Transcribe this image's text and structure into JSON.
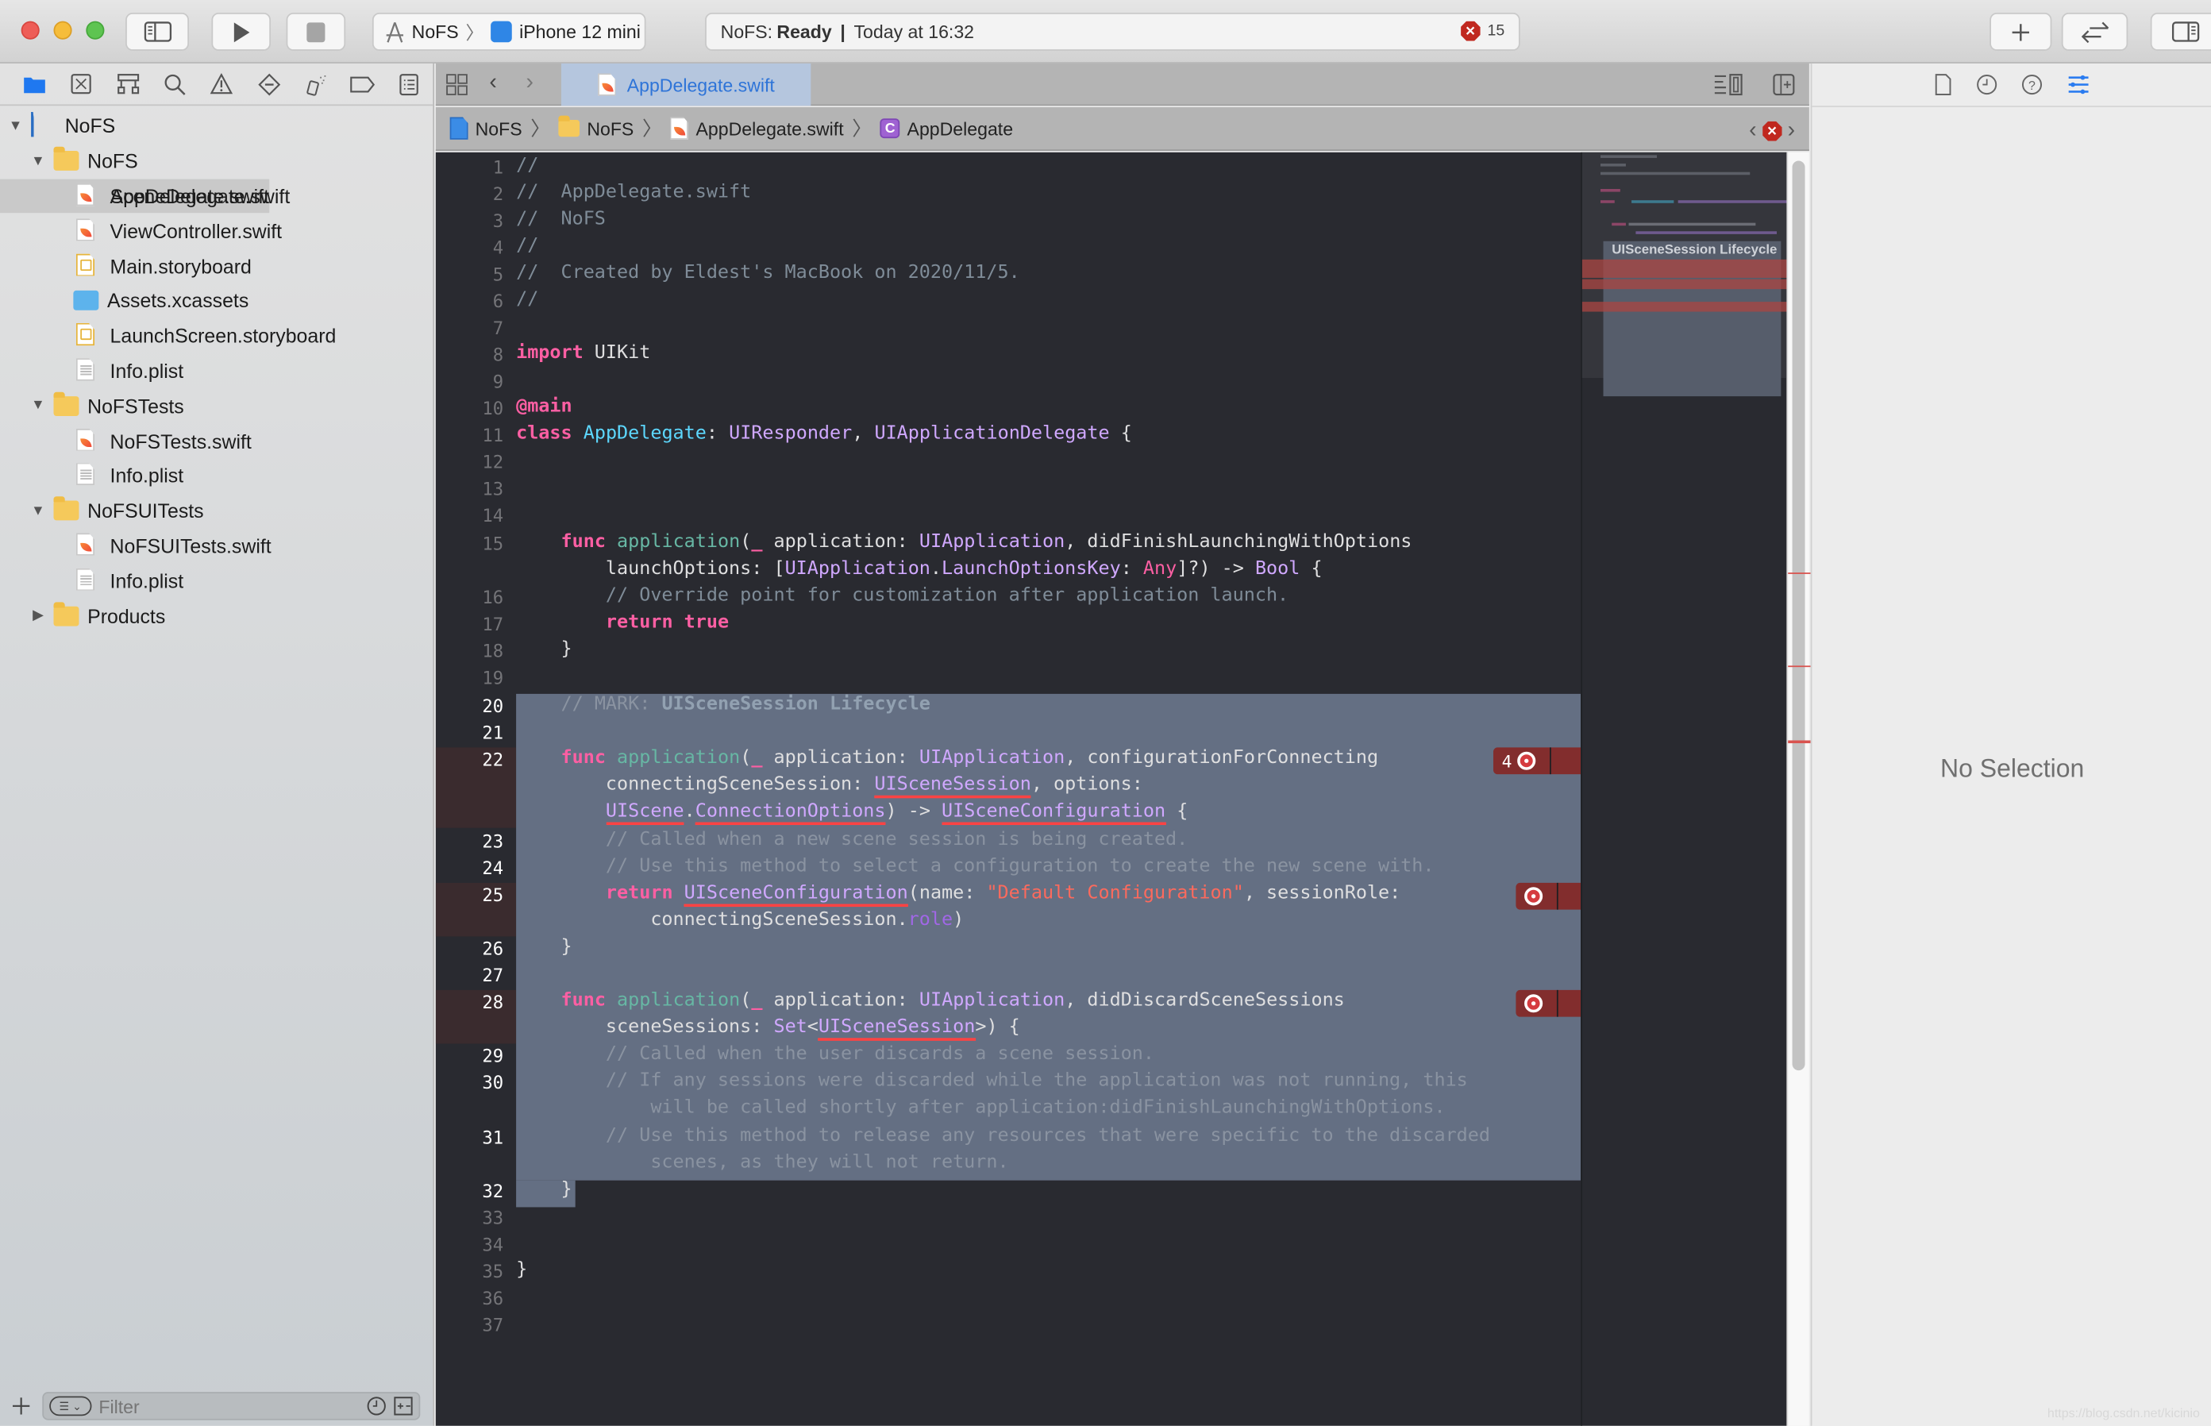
{
  "toolbar": {
    "scheme": {
      "project": "NoFS",
      "device": "iPhone 12 mini"
    },
    "status": {
      "project_prefix": "NoFS:",
      "state": "Ready",
      "separator": "|",
      "time": "Today at 16:32",
      "error_count": "15"
    },
    "buttons": {
      "add": "+",
      "toggle_sidebar": "navigator",
      "run": "run",
      "stop": "stop",
      "code_review": "code-review",
      "inspector": "inspector"
    }
  },
  "navigator": {
    "tree": [
      {
        "label": "NoFS",
        "type": "project",
        "level": 0,
        "expanded": true
      },
      {
        "label": "NoFS",
        "type": "folder",
        "level": 1,
        "expanded": true
      },
      {
        "label": "AppDelegate.swift",
        "type": "swift",
        "level": 2,
        "selected": true
      },
      {
        "label": "SceneDelegate.swift",
        "type": "swift",
        "level": 2
      },
      {
        "label": "ViewController.swift",
        "type": "swift",
        "level": 2
      },
      {
        "label": "Main.storyboard",
        "type": "storyboard",
        "level": 2
      },
      {
        "label": "Assets.xcassets",
        "type": "assets",
        "level": 2
      },
      {
        "label": "LaunchScreen.storyboard",
        "type": "storyboard",
        "level": 2
      },
      {
        "label": "Info.plist",
        "type": "plist",
        "level": 2
      },
      {
        "label": "NoFSTests",
        "type": "folder",
        "level": 1,
        "expanded": true
      },
      {
        "label": "NoFSTests.swift",
        "type": "swift",
        "level": 2
      },
      {
        "label": "Info.plist",
        "type": "plist",
        "level": 2
      },
      {
        "label": "NoFSUITests",
        "type": "folder",
        "level": 1,
        "expanded": true
      },
      {
        "label": "NoFSUITests.swift",
        "type": "swift",
        "level": 2
      },
      {
        "label": "Info.plist",
        "type": "plist",
        "level": 2
      },
      {
        "label": "Products",
        "type": "folder",
        "level": 1,
        "expanded": false
      }
    ],
    "filter_placeholder": "Filter"
  },
  "editor": {
    "tab": "AppDelegate.swift",
    "jumpbar": [
      "NoFS",
      "NoFS",
      "AppDelegate.swift",
      "AppDelegate"
    ],
    "minimap_mark": "UISceneSession Lifecycle",
    "issue_count_badge": "4"
  },
  "inspector": {
    "empty_text": "No Selection"
  },
  "watermark": "https://blog.csdn.net/kicinio"
}
